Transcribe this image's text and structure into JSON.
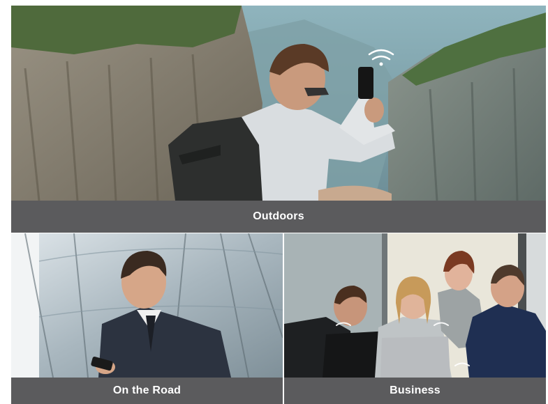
{
  "tiles": {
    "outdoors": {
      "label": "Outdoors"
    },
    "on_the_road": {
      "label": "On the Road"
    },
    "business": {
      "label": "Business"
    }
  },
  "colors": {
    "caption_bar": "#5b5b5d",
    "caption_text": "#ffffff"
  },
  "icons": [
    "wifi-signal-icon"
  ]
}
